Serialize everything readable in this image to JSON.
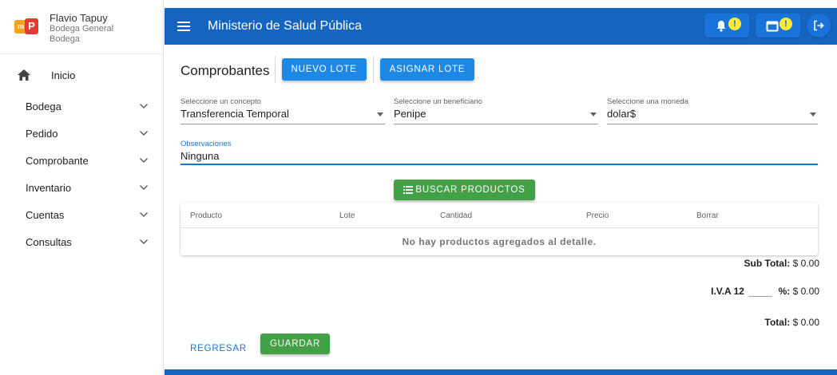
{
  "user": {
    "name": "Flavio Tapuy",
    "line1": "Bodega General",
    "line2": "Bodega"
  },
  "sidebar": {
    "items": [
      {
        "label": "Inicio"
      },
      {
        "label": "Bodega"
      },
      {
        "label": "Pedido"
      },
      {
        "label": "Comprobante"
      },
      {
        "label": "Inventario"
      },
      {
        "label": "Cuentas"
      },
      {
        "label": "Consultas"
      }
    ]
  },
  "topbar": {
    "title": "Ministerio de Salud Pública",
    "notif_badge": "!",
    "calendar_badge": "!"
  },
  "header": {
    "title": "Comprobantes",
    "nuevo_lote": "NUEVO LOTE",
    "asignar_lote": "ASIGNAR LOTE"
  },
  "form": {
    "concepto": {
      "label": "Seleccione un concepto",
      "value": "Transferencia Temporal"
    },
    "beneficiario": {
      "label": "Seleccione un beneficiario",
      "value": "Penipe"
    },
    "moneda": {
      "label": "Seleccione una moneda",
      "value": "dolar$"
    },
    "observaciones": {
      "label": "Observaciones",
      "value": "Ninguna"
    }
  },
  "buscar_label": "BUSCAR PRODUCTOS",
  "table": {
    "columns": [
      "Producto",
      "Lote",
      "Cantidad",
      "Precio",
      "Borrar"
    ],
    "empty_message": "No hay productos agregados al detalle."
  },
  "totals": {
    "subtotal_label": "Sub Total:",
    "subtotal_value": "$ 0.00",
    "iva_label": "I.V.A 12",
    "iva_suffix": "%:",
    "iva_value": "$ 0.00",
    "total_label": "Total:",
    "total_value": "$ 0.00"
  },
  "footer": {
    "regresar": "REGRESAR",
    "guardar": "GUARDAR"
  },
  "colors": {
    "primary": "#1565c0",
    "button_blue": "#1e88e5",
    "button_green": "#43a047",
    "badge": "#ffeb3b"
  }
}
